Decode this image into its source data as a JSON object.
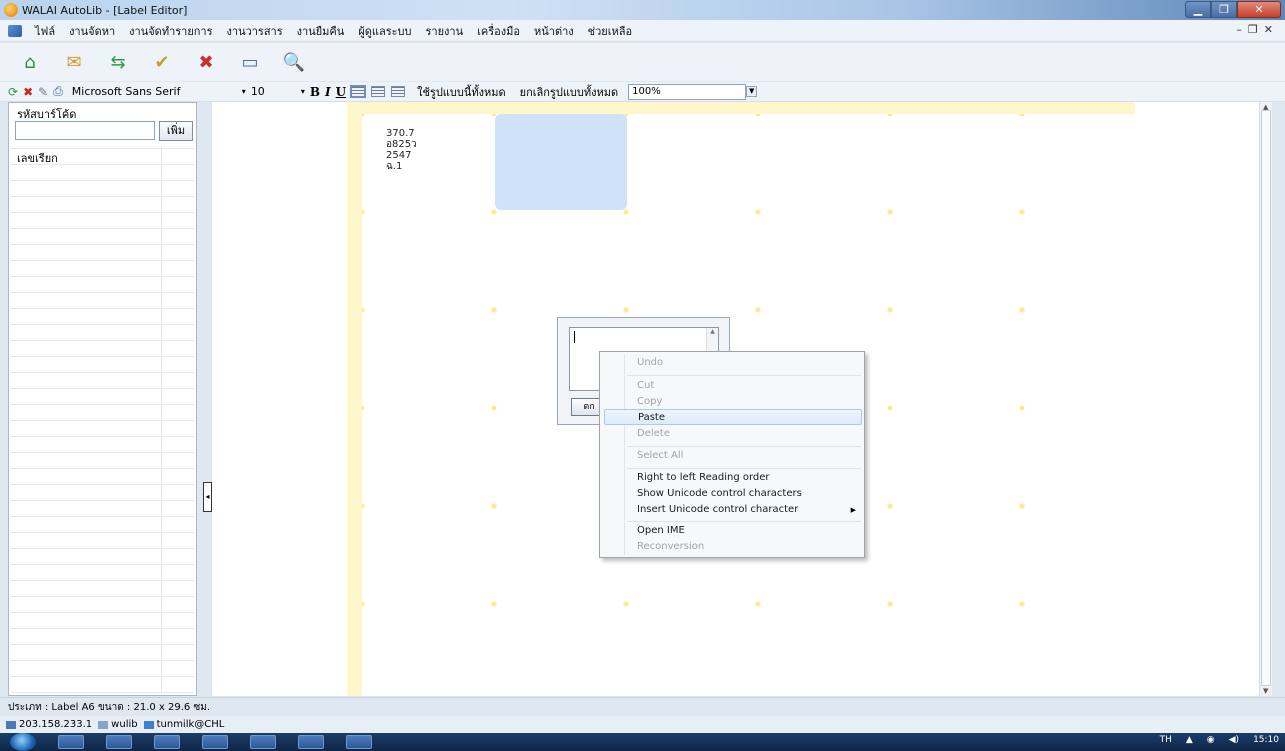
{
  "window": {
    "title": "WALAI AutoLib - [Label Editor]"
  },
  "menu": {
    "items": [
      "ไฟล์",
      "งานจัดหา",
      "งานจัดทำรายการ",
      "งานวารสาร",
      "งานยืมคืน",
      "ผู้ดูแลระบบ",
      "รายงาน",
      "เครื่องมือ",
      "หน้าต่าง",
      "ช่วยเหลือ"
    ]
  },
  "formatbar": {
    "font_name": "Microsoft Sans Serif",
    "font_size": "10",
    "bold": "B",
    "italic": "I",
    "underline": "U",
    "apply_all": "ใช้รูปแบบนี้ทั้งหมด",
    "cancel_all": "ยกเลิกรูปแบบทั้งหมด",
    "zoom": "100%"
  },
  "leftpanel": {
    "barcode_label": "รหัสบาร์โค้ด",
    "add_button": "เพิ่ม",
    "call_number_header": "เลขเรียก"
  },
  "label": {
    "lines": [
      "370.7",
      "อ825ว",
      "2547",
      "ฉ.1"
    ]
  },
  "dialog": {
    "ok_button": "ตก"
  },
  "context_menu": {
    "undo": "Undo",
    "cut": "Cut",
    "copy": "Copy",
    "paste": "Paste",
    "delete": "Delete",
    "select_all": "Select All",
    "rtl": "Right to left Reading order",
    "show_unicode": "Show Unicode control characters",
    "insert_unicode": "Insert Unicode control character",
    "open_ime": "Open IME",
    "reconversion": "Reconversion"
  },
  "status": {
    "label_type": "ประเภท : Label A6  ขนาด : 21.0 x 29.6 ซม.",
    "ip": "203.158.233.1",
    "db": "wulib",
    "user": "tunmilk@CHL"
  },
  "tray": {
    "lang": "TH",
    "time": "15:10"
  }
}
